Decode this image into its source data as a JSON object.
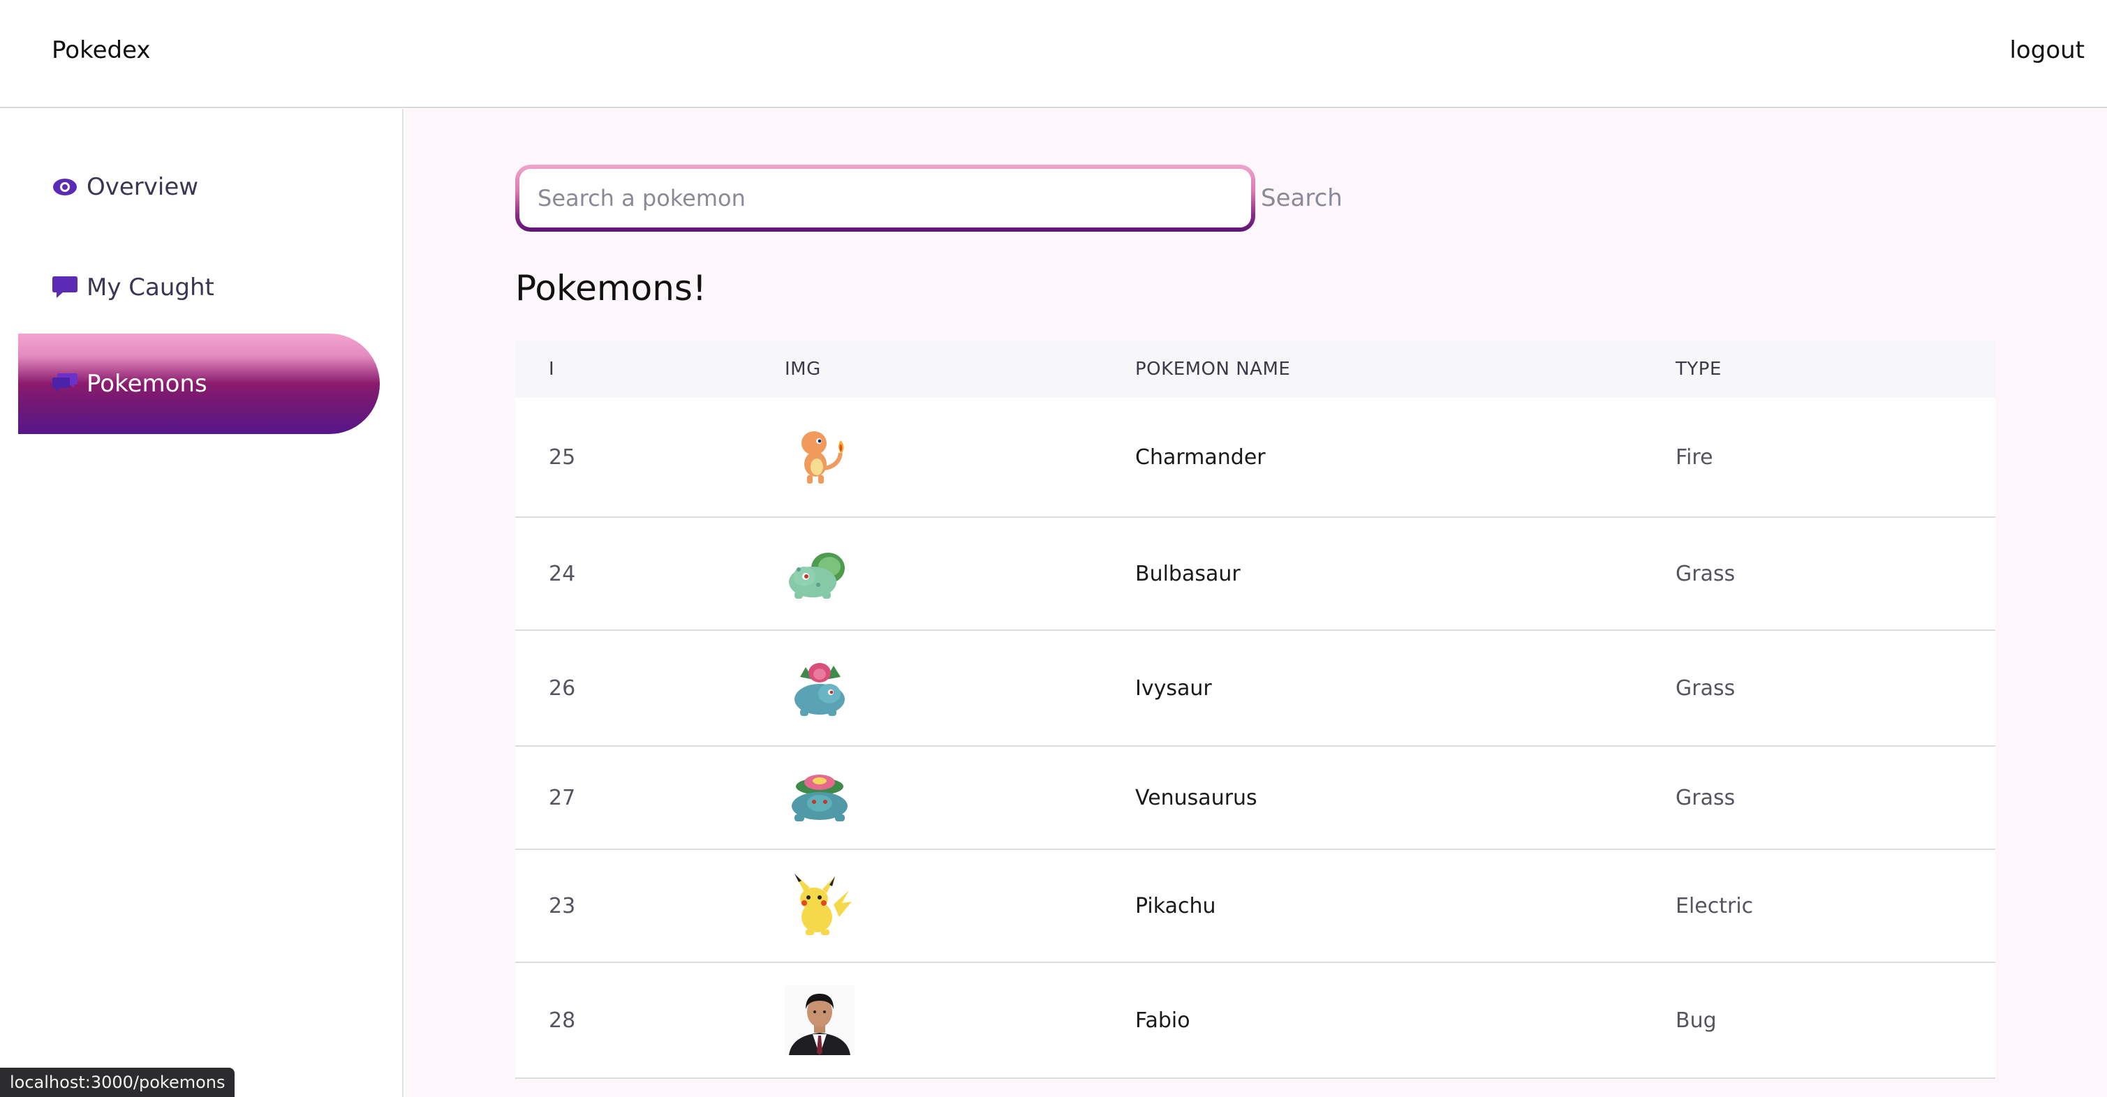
{
  "header": {
    "brand": "Pokedex",
    "logout_label": "logout"
  },
  "sidebar": {
    "items": [
      {
        "label": "Overview",
        "icon": "eye-icon",
        "active": false
      },
      {
        "label": "My Caught",
        "icon": "chat-bubble-icon",
        "active": false
      },
      {
        "label": "Pokemons",
        "icon": "chat-bubbles-icon",
        "active": true
      }
    ]
  },
  "search": {
    "placeholder": "Search a pokemon",
    "value": "",
    "button_label": "Search"
  },
  "main": {
    "heading": "Pokemons!"
  },
  "table": {
    "columns": [
      "I",
      "IMG",
      "POKEMON NAME",
      "TYPE"
    ],
    "rows": [
      {
        "id": "25",
        "image": "charmander-sprite",
        "name": "Charmander",
        "type": "Fire"
      },
      {
        "id": "24",
        "image": "bulbasaur-sprite",
        "name": "Bulbasaur",
        "type": "Grass"
      },
      {
        "id": "26",
        "image": "ivysaur-sprite",
        "name": "Ivysaur",
        "type": "Grass"
      },
      {
        "id": "27",
        "image": "venusaur-sprite",
        "name": "Venusaurus",
        "type": "Grass"
      },
      {
        "id": "23",
        "image": "pikachu-sprite",
        "name": "Pikachu",
        "type": "Electric"
      },
      {
        "id": "28",
        "image": "person-photo",
        "name": "Fabio",
        "type": "Bug"
      }
    ]
  },
  "status_url": "localhost:3000/pokemons",
  "colors": {
    "accent_pink": "#f3a3cf",
    "accent_purple": "#57168a",
    "main_bg": "#fdf7fc"
  }
}
